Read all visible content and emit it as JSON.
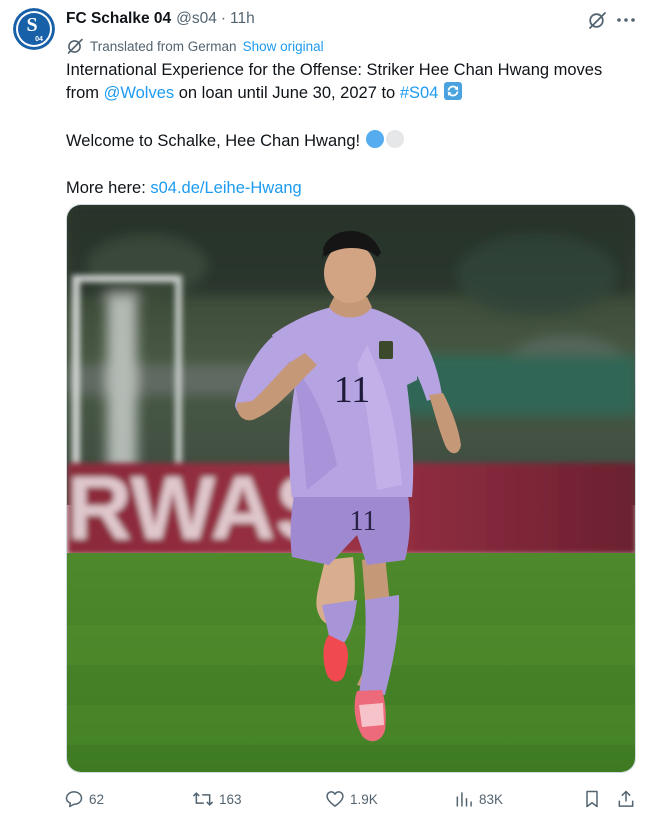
{
  "account": {
    "name": "FC Schalke 04",
    "handle": "@s04",
    "separator": "·",
    "time": "11h",
    "avatar_icon": "schalke-crest-icon",
    "avatar_letters": "S",
    "avatar_digits": "04"
  },
  "translation": {
    "label": "Translated from German",
    "show_original": "Show original"
  },
  "tweet": {
    "line1_text": "International Experience for the Offense: Striker Hee Chan Hwang moves from ",
    "mention": "@Wolves",
    "line1_after": " on loan until June 30, 2027 to ",
    "hashtag": "#S04",
    "welcome": "Welcome to Schalke, Hee Chan Hwang! ",
    "more_prefix": "More here: ",
    "link": "s04.de/Leihe-Hwang"
  },
  "media": {
    "subject": "player",
    "shirt_number": "11",
    "board_text": "RWAS"
  },
  "actions": {
    "replies": "62",
    "reposts": "163",
    "likes": "1.9K",
    "views": "83K"
  },
  "colors": {
    "accent": "#1d9bf0",
    "text": "#0f1419",
    "muted": "#536471",
    "schalke_blue": "#1860a8",
    "jersey_lilac": "#ad98dc",
    "pitch_green": "#4e8a2c"
  },
  "icons": {
    "emoji_refresh": "repeat-button-emoji",
    "emoji_blue_circle": "blue-circle-emoji",
    "emoji_white_circle": "white-circle-emoji"
  }
}
